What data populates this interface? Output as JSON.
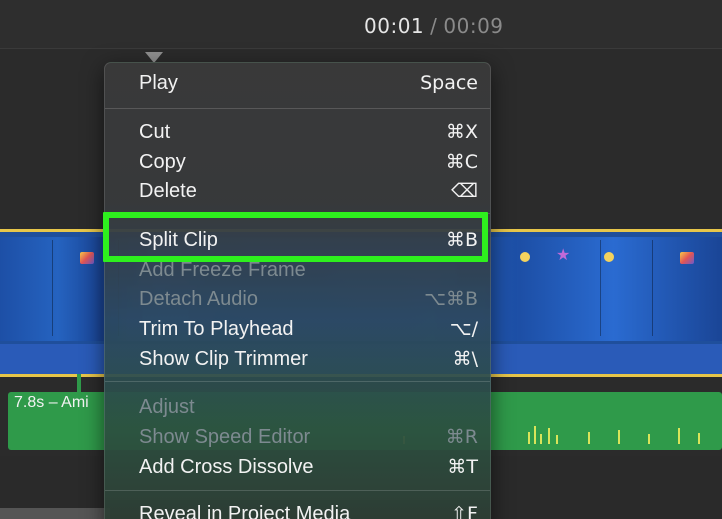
{
  "timecode": {
    "current": "00:01",
    "separator": "/",
    "total": "00:09"
  },
  "audio_clip": {
    "label": "7.8s – Ami"
  },
  "menu": {
    "items": [
      {
        "label": "Play",
        "shortcut": "Space",
        "enabled": true
      },
      {
        "label": "Cut",
        "shortcut": "⌘X",
        "enabled": true
      },
      {
        "label": "Copy",
        "shortcut": "⌘C",
        "enabled": true
      },
      {
        "label": "Delete",
        "shortcut": "⌫",
        "enabled": true
      },
      {
        "label": "Split Clip",
        "shortcut": "⌘B",
        "enabled": true,
        "highlighted": true
      },
      {
        "label": "Add Freeze Frame",
        "shortcut": "",
        "enabled": false
      },
      {
        "label": "Detach Audio",
        "shortcut": "⌥⌘B",
        "enabled": false
      },
      {
        "label": "Trim To Playhead",
        "shortcut": "⌥/",
        "enabled": true
      },
      {
        "label": "Show Clip Trimmer",
        "shortcut": "⌘\\",
        "enabled": true
      },
      {
        "label": "Adjust",
        "shortcut": "",
        "enabled": false
      },
      {
        "label": "Show Speed Editor",
        "shortcut": "⌘R",
        "enabled": false
      },
      {
        "label": "Add Cross Dissolve",
        "shortcut": "⌘T",
        "enabled": true
      },
      {
        "label": "Reveal in Project Media",
        "shortcut": "⇧F",
        "enabled": true
      }
    ]
  },
  "colors": {
    "highlight": "#2ef01e",
    "clip_border": "#e7c64a",
    "audio": "#2f9a4a",
    "video": "#1f4f9c"
  }
}
